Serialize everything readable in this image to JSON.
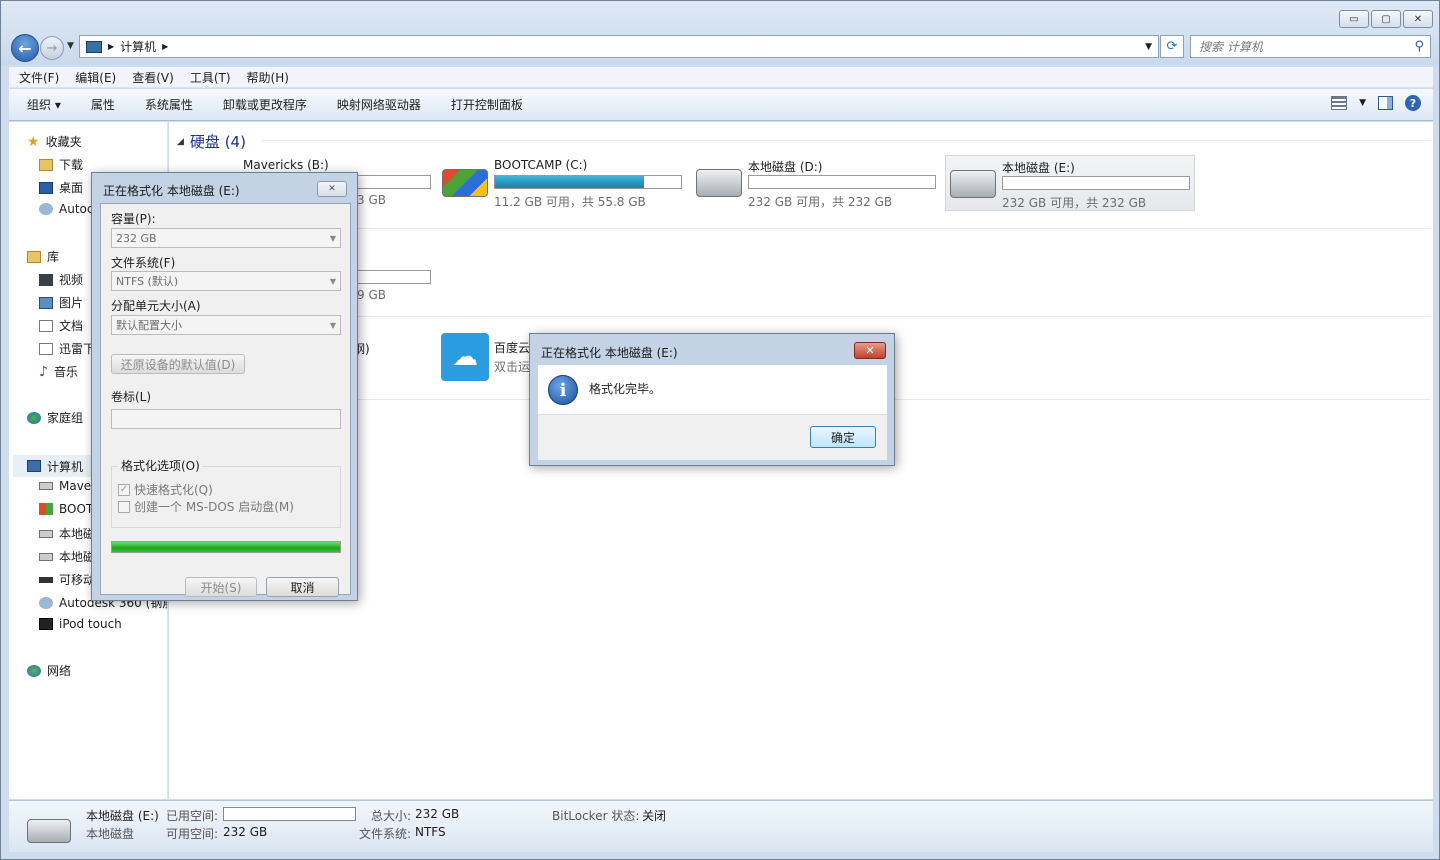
{
  "window": {
    "caption_buttons": {
      "minimize": "▭",
      "maximize": "▢",
      "close": "✕"
    }
  },
  "address": {
    "path": "计算机",
    "search_placeholder": "搜索 计算机"
  },
  "menu": [
    "文件(F)",
    "编辑(E)",
    "查看(V)",
    "工具(T)",
    "帮助(H)"
  ],
  "toolbar": [
    "组织 ▾",
    "属性",
    "系统属性",
    "卸载或更改程序",
    "映射网络驱动器",
    "打开控制面板"
  ],
  "nav": {
    "favorites": {
      "label": "收藏夹",
      "items": [
        "下载",
        "桌面",
        "Autoc"
      ]
    },
    "libraries": {
      "label": "库",
      "items": [
        "视频",
        "图片",
        "文档",
        "迅雷下",
        "音乐"
      ]
    },
    "homegroup": "家庭组",
    "computer": {
      "label": "计算机",
      "items": [
        "Mave",
        "BOOT",
        "本地磁",
        "本地磁",
        "可移动",
        "Autodesk 360 (钢筋",
        "iPod touch"
      ]
    },
    "network": "网络"
  },
  "content": {
    "group_label": "硬盘 (4)",
    "drives": [
      {
        "name": "Mavericks (B:)",
        "info": "3 GB",
        "used_fraction": 0
      },
      {
        "name": "BOOTCAMP (C:)",
        "info": "11.2 GB 可用，共 55.8 GB",
        "used_fraction": 0.8
      },
      {
        "name": "本地磁盘 (D:)",
        "info": "232 GB 可用，共 232 GB",
        "used_fraction": 0
      },
      {
        "name": "本地磁盘 (E:)",
        "info": "232 GB 可用，共 232 GB",
        "used_fraction": 0
      }
    ],
    "removable_info": "9 GB",
    "other_partial": "钢)",
    "baidu_name": "百度云",
    "baidu_sub": "双击运"
  },
  "format_dialog": {
    "title": "正在格式化 本地磁盘 (E:)",
    "capacity_label": "容量(P):",
    "capacity_value": "232 GB",
    "fs_label": "文件系统(F)",
    "fs_value": "NTFS (默认)",
    "alloc_label": "分配单元大小(A)",
    "alloc_value": "默认配置大小",
    "restore_button": "还原设备的默认值(D)",
    "volume_label": "卷标(L)",
    "volume_value": "",
    "options_legend": "格式化选项(O)",
    "quick_format": "快速格式化(Q)",
    "msdos": "创建一个 MS-DOS 启动盘(M)",
    "progress_fraction": 1,
    "start_button": "开始(S)",
    "cancel_button": "取消"
  },
  "done_dialog": {
    "title": "正在格式化 本地磁盘 (E:)",
    "message": "格式化完毕。",
    "ok_button": "确定"
  },
  "status": {
    "name": "本地磁盘 (E:)",
    "type": "本地磁盘",
    "used_label": "已用空间:",
    "free_label": "可用空间:",
    "free_value": "232 GB",
    "total_label": "总大小:",
    "total_value": "232 GB",
    "fs_label": "文件系统:",
    "fs_value": "NTFS",
    "bitlocker_label": "BitLocker 状态:",
    "bitlocker_value": "关闭"
  }
}
